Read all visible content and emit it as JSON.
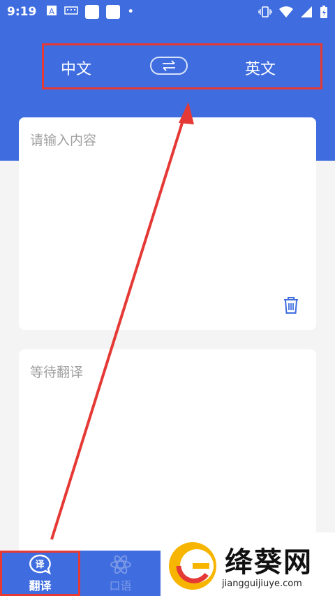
{
  "status_bar": {
    "time": "9:19"
  },
  "lang_bar": {
    "source_lang": "中文",
    "target_lang": "英文"
  },
  "input_card": {
    "placeholder": "请输入内容"
  },
  "output_card": {
    "placeholder": "等待翻译"
  },
  "tabs": [
    {
      "label": "翻译",
      "icon": "translate-bubble-icon",
      "active": true
    },
    {
      "label": "口语",
      "icon": "atom-icon",
      "active": false
    }
  ],
  "watermark": {
    "text": "绛葵网",
    "url": "jiangguijiuye.com"
  },
  "colors": {
    "primary": "#3f6ddf",
    "highlight": "#e53935",
    "background": "#f4f4f4"
  }
}
